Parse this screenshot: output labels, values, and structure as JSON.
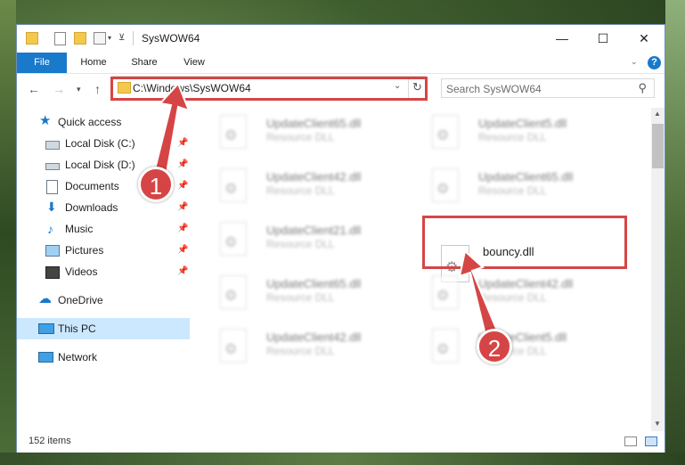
{
  "window": {
    "title": "SysWOW64"
  },
  "window_controls": {
    "minimize": "—",
    "maximize": "☐",
    "close": "✕"
  },
  "ribbon": {
    "tabs": [
      "File",
      "Home",
      "Share",
      "View"
    ]
  },
  "address": {
    "path": "C:\\Windows\\SysWOW64"
  },
  "search": {
    "placeholder": "Search SysWOW64"
  },
  "nav": {
    "quick_access": "Quick access",
    "items": [
      "Local Disk (C:)",
      "Local Disk (D:)",
      "Documents",
      "Downloads",
      "Music",
      "Pictures",
      "Videos"
    ],
    "onedrive": "OneDrive",
    "this_pc": "This PC",
    "network": "Network"
  },
  "files": [
    {
      "name": "UpdateClient65.dll",
      "type": "Resource DLL"
    },
    {
      "name": "UpdateClient5.dll",
      "type": "Resource DLL"
    },
    {
      "name": "UpdateClient42.dll",
      "type": "Resource DLL"
    },
    {
      "name": "UpdateClient65.dll",
      "type": "Resource DLL"
    },
    {
      "name": "UpdateClient21.dll",
      "type": "Resource DLL"
    },
    {
      "name": "bouncy.dll",
      "type": ""
    },
    {
      "name": "UpdateClient65.dll",
      "type": "Resource DLL"
    },
    {
      "name": "UpdateClient42.dll",
      "type": "Resource DLL"
    },
    {
      "name": "UpdateClient42.dll",
      "type": "Resource DLL"
    },
    {
      "name": "UpdateClient5.dll",
      "type": "Resource DLL"
    }
  ],
  "status": {
    "item_count": "152 items"
  },
  "annotations": {
    "step1": "1",
    "step2": "2",
    "color": "#d64545"
  }
}
